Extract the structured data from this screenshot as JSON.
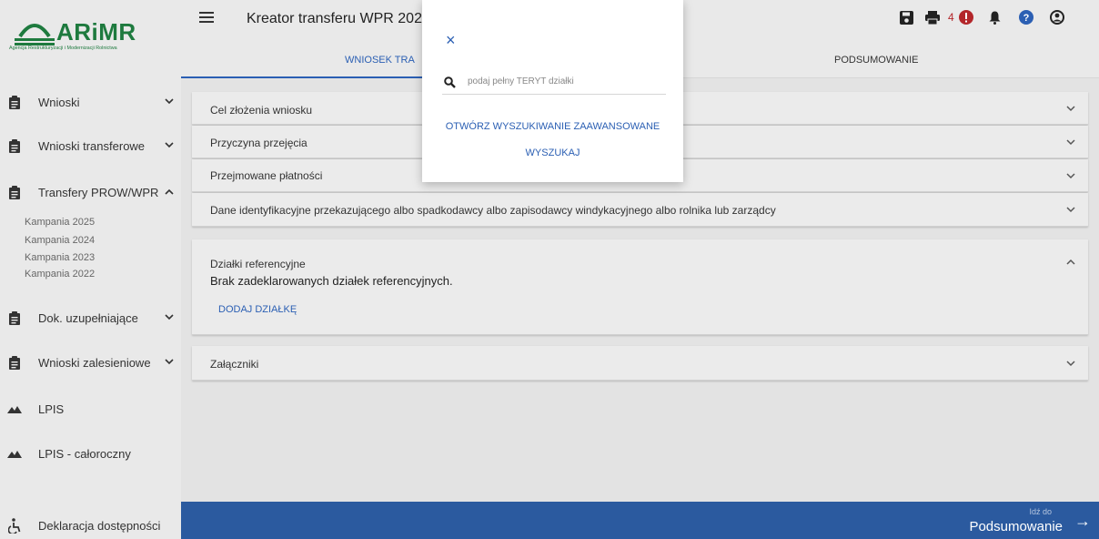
{
  "app": {
    "logo_text": "ARiMR",
    "logo_subtitle": "Agencja Restrukturyzacji i Modernizacji Rolnictwa",
    "title": "Kreator transferu WPR 202",
    "colors": {
      "accent": "#2b5fb3",
      "brand": "#1e7a3e",
      "bottom_bar": "#2b5a9f",
      "alert": "#b3262a"
    }
  },
  "sidebar": {
    "items": [
      {
        "label": "Wnioski",
        "icon": "clipboard-icon",
        "expanded": false
      },
      {
        "label": "Wnioski transferowe",
        "icon": "clipboard-icon",
        "expanded": false
      },
      {
        "label": "Transfery PROW/WPR",
        "icon": "clipboard-icon",
        "expanded": true
      },
      {
        "label": "Dok. uzupełniające",
        "icon": "clipboard-icon",
        "expanded": false
      },
      {
        "label": "Wnioski zalesieniowe",
        "icon": "clipboard-icon",
        "expanded": false
      },
      {
        "label": "LPIS",
        "icon": "mountain-icon"
      },
      {
        "label": "LPIS - całoroczny",
        "icon": "mountain-icon"
      },
      {
        "label": "Deklaracja dostępności",
        "icon": "accessibility-icon"
      }
    ],
    "sub_items": [
      "Kampania 2025",
      "Kampania 2024",
      "Kampania 2023",
      "Kampania 2022"
    ]
  },
  "header": {
    "tabs": [
      {
        "label": "WNIOSEK TRA",
        "active": true
      },
      {
        "label": "PODSUMOWANIE",
        "active": false
      }
    ],
    "notification_count": "4",
    "icons": [
      "save-icon",
      "print-icon",
      "alert-icon",
      "bell-icon",
      "help-icon",
      "user-icon"
    ]
  },
  "panels": {
    "p1": {
      "title": "Cel złożenia wniosku"
    },
    "p2": {
      "title": "Przyczyna przejęcia"
    },
    "p3": {
      "title": "Przejmowane płatności"
    },
    "p4": {
      "title": "Dane identyfikacyjne przekazującego albo spadkodawcy albo zapisodawcy windykacyjnego albo rolnika lub zarządcy"
    },
    "p5": {
      "title": "Działki referencyjne",
      "empty_text": "Brak zadeklarowanych działek referencyjnych.",
      "add_button": "DODAJ DZIAŁKĘ"
    },
    "p6": {
      "title": "Załączniki"
    }
  },
  "modal": {
    "close_label": "×",
    "search_placeholder": "podaj pełny TERYT działki",
    "advanced_button": "OTWÓRZ WYSZUKIWANIE ZAAWANSOWANE",
    "search_button": "WYSZUKAJ"
  },
  "footer": {
    "goto_small": "Idź do",
    "goto_label": "Podsumowanie",
    "arrow": "→"
  }
}
